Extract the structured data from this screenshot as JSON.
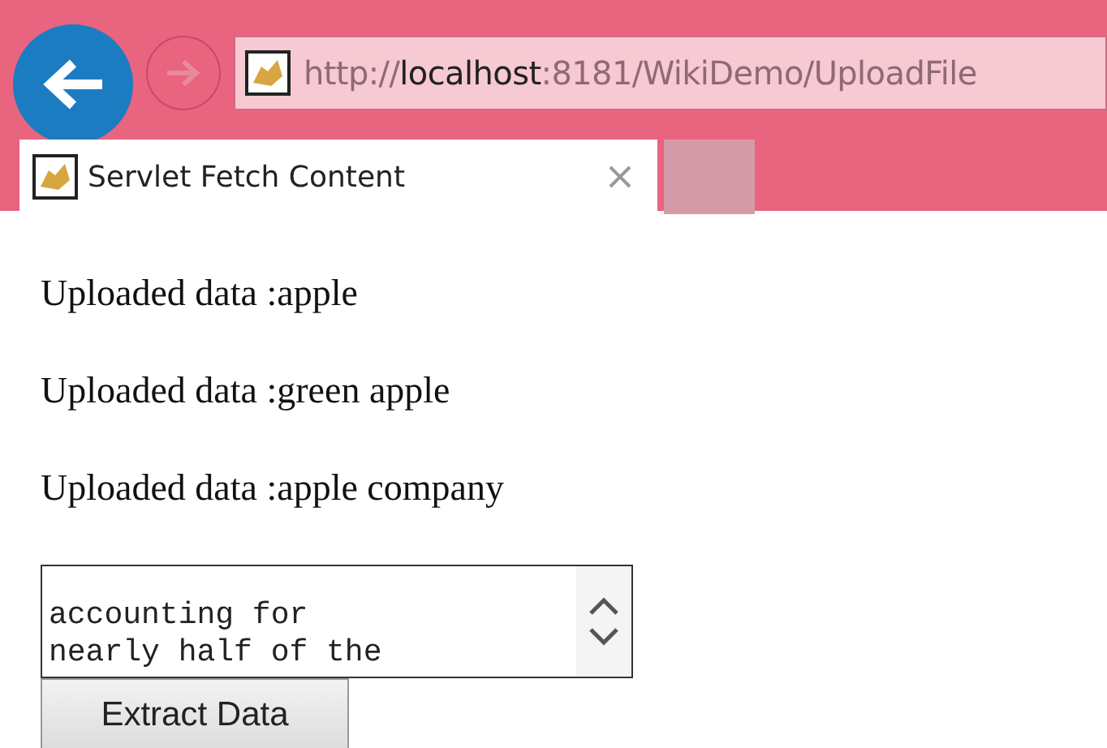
{
  "browser": {
    "url_prefix": "http://",
    "url_host": "localhost",
    "url_rest": ":8181/WikiDemo/UploadFile",
    "tabs": [
      {
        "title": "Servlet Fetch Content",
        "selected": true
      }
    ]
  },
  "page": {
    "lines": [
      "Uploaded data :apple",
      "Uploaded data :green apple",
      "Uploaded data :apple company"
    ],
    "textarea": {
      "value": "accounting for\nnearly half of the"
    },
    "button": "Extract Data"
  }
}
